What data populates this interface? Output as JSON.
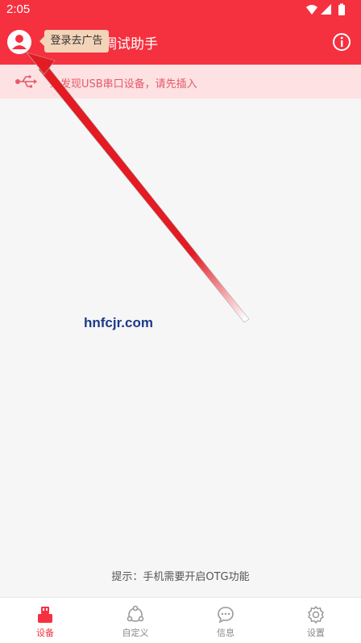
{
  "status_bar": {
    "time": "2:05"
  },
  "app_bar": {
    "title_visible": "调试助手",
    "tooltip": "登录去广告"
  },
  "notice": {
    "text": "未发现USB串口设备，请先插入"
  },
  "watermark": "hnfcjr.com",
  "hint": "提示：手机需要开启OTG功能",
  "bottom_nav": [
    {
      "label": "设备",
      "icon": "usb-device-icon",
      "active": true
    },
    {
      "label": "自定义",
      "icon": "custom-icon",
      "active": false
    },
    {
      "label": "信息",
      "icon": "message-icon",
      "active": false
    },
    {
      "label": "设置",
      "icon": "gear-icon",
      "active": false
    }
  ],
  "colors": {
    "primary": "#f5313f",
    "notice_bg": "#fde1e3",
    "notice_text": "#e45a67",
    "tooltip_bg": "#f4d4b9"
  }
}
